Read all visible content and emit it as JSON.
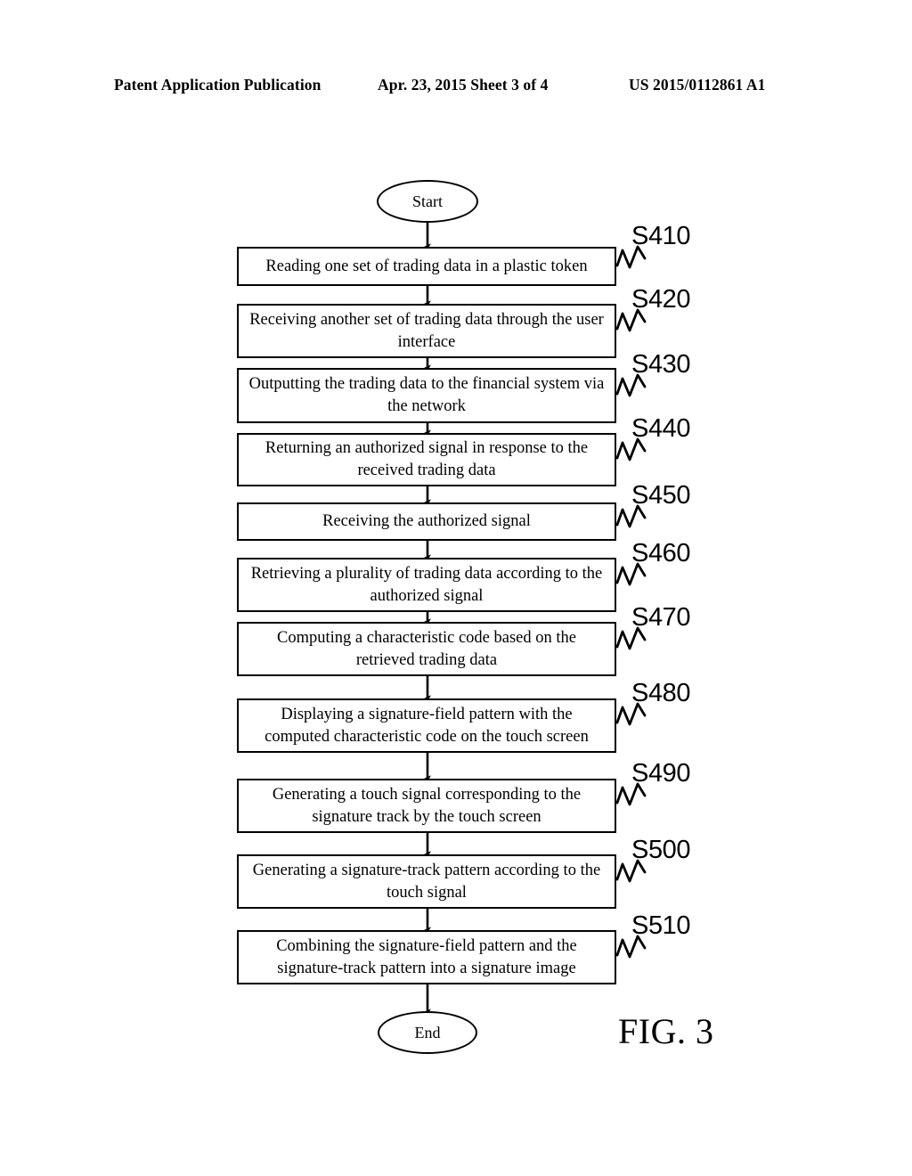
{
  "header": {
    "publication": "Patent Application Publication",
    "date_sheet": "Apr. 23, 2015  Sheet 3 of 4",
    "publication_number": "US 2015/0112861 A1"
  },
  "figure": {
    "caption": "FIG. 3"
  },
  "flowchart": {
    "start_label": "Start",
    "end_label": "End",
    "steps": [
      {
        "ref": "S410",
        "text": "Reading one set of trading data in a plastic token"
      },
      {
        "ref": "S420",
        "text": "Receiving another set of trading data through the user interface"
      },
      {
        "ref": "S430",
        "text": "Outputting the trading data to the financial system via the network"
      },
      {
        "ref": "S440",
        "text": "Returning an authorized signal in response to the received trading data"
      },
      {
        "ref": "S450",
        "text": "Receiving the authorized signal"
      },
      {
        "ref": "S460",
        "text": "Retrieving a plurality of trading data according to the authorized signal"
      },
      {
        "ref": "S470",
        "text": "Computing a characteristic code based on the retrieved trading data"
      },
      {
        "ref": "S480",
        "text": "Displaying a signature-field pattern with the computed characteristic code on the touch screen"
      },
      {
        "ref": "S490",
        "text": "Generating a touch signal corresponding to the signature track by the touch screen"
      },
      {
        "ref": "S500",
        "text": "Generating a signature-track pattern according to the touch signal"
      },
      {
        "ref": "S510",
        "text": "Combining the signature-field pattern and the signature-track pattern into a signature image"
      }
    ]
  },
  "chart_data": {
    "type": "diagram",
    "diagram_type": "flowchart",
    "orientation": "top-to-bottom",
    "title": "FIG. 3",
    "nodes": [
      {
        "id": "start",
        "shape": "ellipse",
        "label": "Start"
      },
      {
        "id": "S410",
        "shape": "rectangle",
        "label": "Reading one set of trading data in a plastic token"
      },
      {
        "id": "S420",
        "shape": "rectangle",
        "label": "Receiving another set of trading data through the user interface"
      },
      {
        "id": "S430",
        "shape": "rectangle",
        "label": "Outputting the trading data to the financial system via the network"
      },
      {
        "id": "S440",
        "shape": "rectangle",
        "label": "Returning an authorized signal in response to the received trading data"
      },
      {
        "id": "S450",
        "shape": "rectangle",
        "label": "Receiving the authorized signal"
      },
      {
        "id": "S460",
        "shape": "rectangle",
        "label": "Retrieving a plurality of trading data according to the authorized signal"
      },
      {
        "id": "S470",
        "shape": "rectangle",
        "label": "Computing a characteristic code based on the retrieved trading data"
      },
      {
        "id": "S480",
        "shape": "rectangle",
        "label": "Displaying a signature-field pattern with the computed characteristic code on the touch screen"
      },
      {
        "id": "S490",
        "shape": "rectangle",
        "label": "Generating a touch signal corresponding to the signature track by the touch screen"
      },
      {
        "id": "S500",
        "shape": "rectangle",
        "label": "Generating a signature-track pattern according to the touch signal"
      },
      {
        "id": "S510",
        "shape": "rectangle",
        "label": "Combining the signature-field pattern and the signature-track pattern into a signature image"
      },
      {
        "id": "end",
        "shape": "ellipse",
        "label": "End"
      }
    ],
    "edges": [
      {
        "from": "start",
        "to": "S410"
      },
      {
        "from": "S410",
        "to": "S420"
      },
      {
        "from": "S420",
        "to": "S430"
      },
      {
        "from": "S430",
        "to": "S440"
      },
      {
        "from": "S440",
        "to": "S450"
      },
      {
        "from": "S450",
        "to": "S460"
      },
      {
        "from": "S460",
        "to": "S470"
      },
      {
        "from": "S470",
        "to": "S480"
      },
      {
        "from": "S480",
        "to": "S490"
      },
      {
        "from": "S490",
        "to": "S500"
      },
      {
        "from": "S500",
        "to": "S510"
      },
      {
        "from": "S510",
        "to": "end"
      }
    ]
  }
}
